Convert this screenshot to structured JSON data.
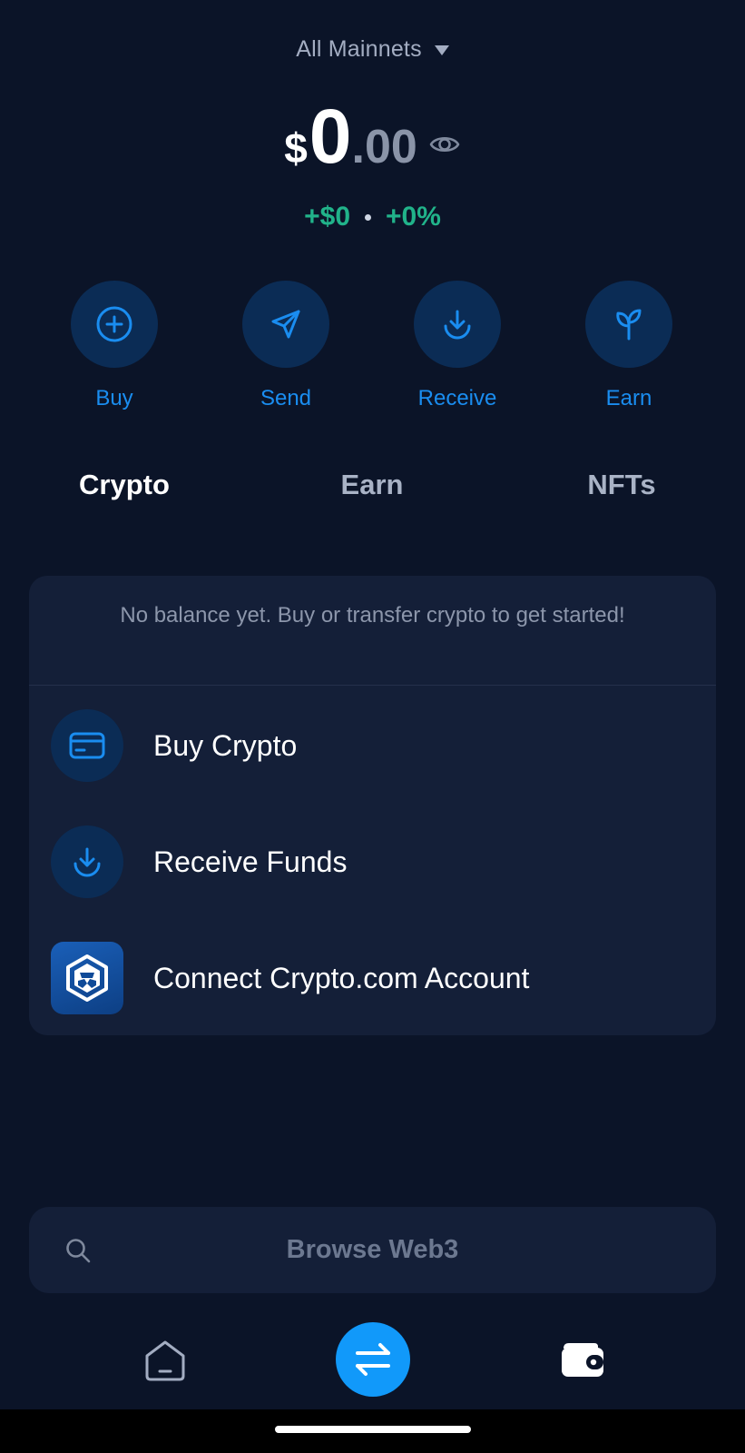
{
  "network": {
    "label": "All Mainnets"
  },
  "balance": {
    "currency": "$",
    "integer": "0",
    "decimal": ".00"
  },
  "change": {
    "amount": "+$0",
    "percent": "+0%"
  },
  "actions": [
    {
      "label": "Buy",
      "icon": "plus-circle-icon"
    },
    {
      "label": "Send",
      "icon": "paper-plane-icon"
    },
    {
      "label": "Receive",
      "icon": "download-arrow-icon"
    },
    {
      "label": "Earn",
      "icon": "sprout-icon"
    }
  ],
  "tabs": [
    {
      "label": "Crypto",
      "active": true
    },
    {
      "label": "Earn",
      "active": false
    },
    {
      "label": "NFTs",
      "active": false
    }
  ],
  "card": {
    "empty_message": "No balance yet. Buy or transfer crypto to get started!",
    "rows": [
      {
        "label": "Buy Crypto",
        "icon": "credit-card-icon"
      },
      {
        "label": "Receive Funds",
        "icon": "download-arrow-icon"
      },
      {
        "label": "Connect Crypto.com Account",
        "icon": "crypto-com-logo-icon"
      }
    ]
  },
  "search": {
    "placeholder": "Browse Web3"
  },
  "bottom_nav": {
    "items": [
      "home-icon",
      "swap-icon",
      "wallet-icon"
    ]
  },
  "colors": {
    "background": "#0b1428",
    "card": "#141f38",
    "accent": "#1199fa",
    "positive": "#21b38a"
  }
}
